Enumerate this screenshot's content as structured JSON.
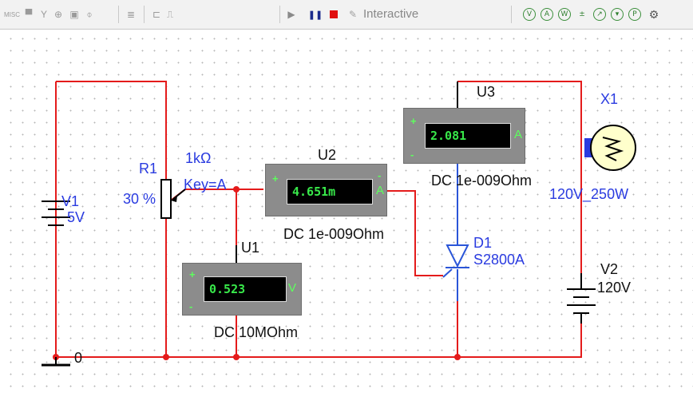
{
  "toolbar": {
    "misc_label": "MISC",
    "mode_label": "Interactive"
  },
  "circuit": {
    "v1": {
      "ref": "V1",
      "value": "5V"
    },
    "v2": {
      "ref": "V2",
      "value": "120V"
    },
    "r1": {
      "ref": "R1",
      "resistance": "1kΩ",
      "key": "Key=A",
      "percent": "30 %"
    },
    "u1": {
      "ref": "U1",
      "reading": "0.523",
      "unit": "V",
      "mode": "DC  10MOhm"
    },
    "u2": {
      "ref": "U2",
      "reading": "4.651m",
      "unit": "A",
      "mode": "DC  1e-009Ohm"
    },
    "u3": {
      "ref": "U3",
      "reading": "2.081",
      "unit": "A",
      "mode": "DC  1e-009Ohm"
    },
    "d1": {
      "ref": "D1",
      "model": "S2800A"
    },
    "x1": {
      "ref": "X1",
      "rating": "120V_250W"
    },
    "ground": {
      "label": "0"
    }
  },
  "colors": {
    "wire": "#e41b1b",
    "label": "#2a3be0",
    "meter_text": "#38e84a"
  },
  "icons": [
    "misc-icon",
    "component-icon",
    "antenna-icon",
    "probe-icon",
    "ttl-icon",
    "connector-icon",
    "ladder-icon",
    "bus-icon",
    "step-icon",
    "play-icon",
    "pause-icon",
    "stop-icon",
    "interactive-wrench-icon",
    "probe-green-icons",
    "settings-gear-icon"
  ]
}
